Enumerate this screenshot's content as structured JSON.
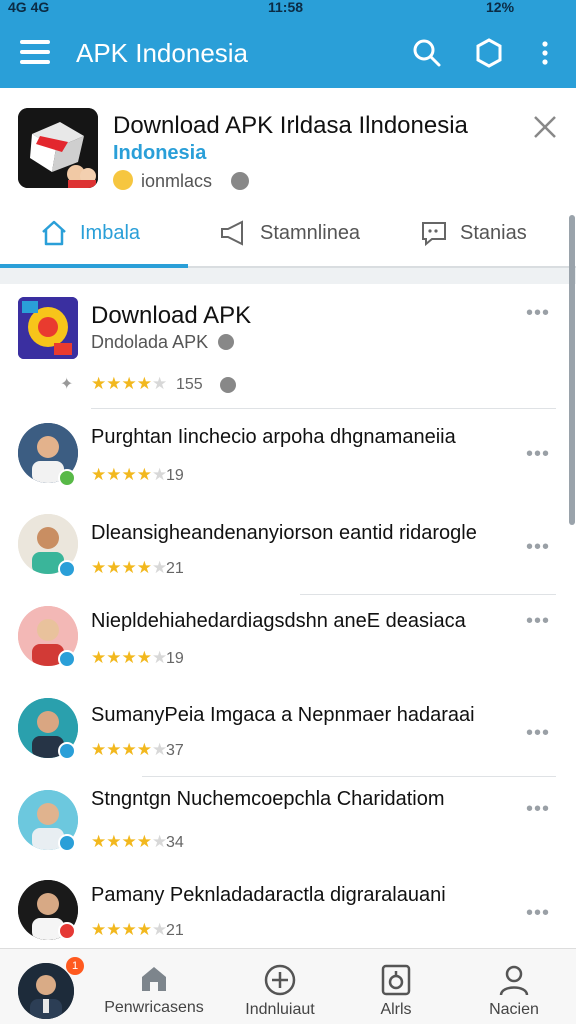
{
  "status_bar": {
    "left": "4G 4G",
    "time": "11:58",
    "right": "12%"
  },
  "app_bar": {
    "title": "APK Indonesia"
  },
  "header": {
    "title": "Download APK Irldasa Ilndonesia",
    "subtitle": "Indonesia",
    "meta": "ionmlacs"
  },
  "tabs": [
    {
      "label": "Imbala",
      "active": true,
      "icon": "home-icon"
    },
    {
      "label": "Stamnlinea",
      "active": false,
      "icon": "megaphone-icon"
    },
    {
      "label": "Stanias",
      "active": false,
      "icon": "chat-icon"
    }
  ],
  "featured": {
    "title": "Download APK",
    "subtitle": "Dndolada APK",
    "rating": 3.5,
    "count": "155"
  },
  "items": [
    {
      "name": "Purghtan Iinchecio arpoha dhgnamaneiia",
      "rating": 4,
      "count": "19"
    },
    {
      "name": "Dleansigheandenanyiorson eantid ridarogle",
      "rating": 4,
      "count": "21"
    },
    {
      "name": "Niepldehiahedardiagsdshn aneE deasiaca",
      "rating": 3.5,
      "count": "19"
    },
    {
      "name": "SumanyPeia Imgaca a Nepnmaer hadaraai",
      "rating": 4,
      "count": "37"
    },
    {
      "name": "Stngntgn Nuchemcoepchla Charidatiom",
      "rating": 3.5,
      "count": "34"
    },
    {
      "name": "Pamany Peknladadaractla digraralauani",
      "rating": 3.5,
      "count": "21"
    }
  ],
  "more_label": "•••",
  "bottom_nav": {
    "badge": "1",
    "items": [
      {
        "label": "Penwricasens",
        "icon": "store-icon"
      },
      {
        "label": "Indnluiaut",
        "icon": "add-circle-icon"
      },
      {
        "label": "Alrls",
        "icon": "app-box-icon"
      },
      {
        "label": "Nacien",
        "icon": "person-icon"
      }
    ]
  },
  "colors": {
    "accent": "#2a9fd8",
    "star": "#f2b81e"
  }
}
